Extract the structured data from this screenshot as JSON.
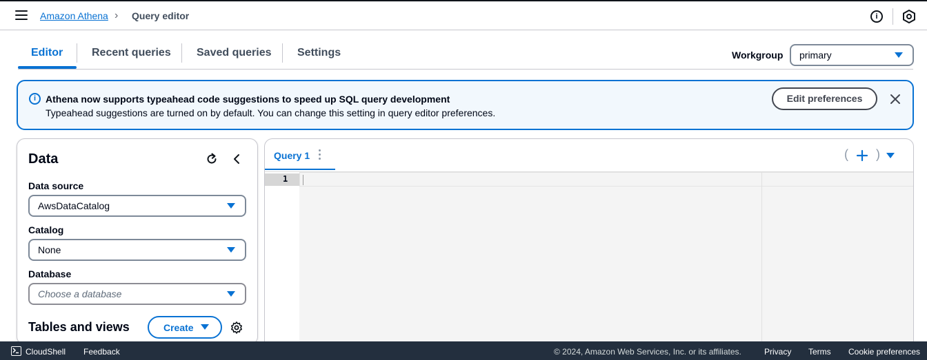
{
  "header": {
    "breadcrumb_link": "Amazon Athena",
    "breadcrumb_separator": "›",
    "breadcrumb_current": "Query editor",
    "info_icon": "info-icon",
    "settings_icon": "hexagon-settings-icon"
  },
  "tabs": [
    {
      "label": "Editor",
      "active": true
    },
    {
      "label": "Recent queries",
      "active": false
    },
    {
      "label": "Saved queries",
      "active": false
    },
    {
      "label": "Settings",
      "active": false
    }
  ],
  "workgroup": {
    "label": "Workgroup",
    "value": "primary"
  },
  "flash": {
    "title": "Athena now supports typeahead code suggestions to speed up SQL query development",
    "body": "Typeahead suggestions are turned on by default. You can change this setting in query editor preferences.",
    "button": "Edit preferences",
    "icon": "info-icon"
  },
  "data_panel": {
    "title": "Data",
    "data_source_label": "Data source",
    "data_source_value": "AwsDataCatalog",
    "catalog_label": "Catalog",
    "catalog_value": "None",
    "database_label": "Database",
    "database_placeholder": "Choose a database",
    "tables_title": "Tables and views",
    "create_label": "Create"
  },
  "editor": {
    "tab_label": "Query 1",
    "line_number": "1",
    "paren_open": "(",
    "paren_close": ")"
  },
  "footer": {
    "cloudshell": "CloudShell",
    "feedback": "Feedback",
    "copyright": "© 2024, Amazon Web Services, Inc. or its affiliates.",
    "privacy": "Privacy",
    "terms": "Terms",
    "cookies": "Cookie preferences"
  },
  "colors": {
    "accent": "#0972d3",
    "flash_bg": "#f2f8fd",
    "footer_bg": "#232f3e",
    "text": "#000716"
  }
}
